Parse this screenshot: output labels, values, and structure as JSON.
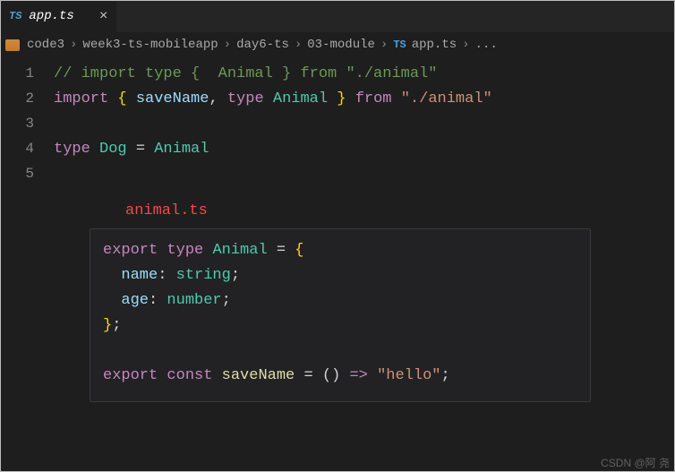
{
  "tab": {
    "icon_label": "TS",
    "filename": "app.ts",
    "close_glyph": "×"
  },
  "breadcrumb": {
    "items": [
      "code3",
      "week3-ts-mobileapp",
      "day6-ts",
      "03-module"
    ],
    "file_badge": "TS",
    "file": "app.ts",
    "trailing": "...",
    "sep": "›"
  },
  "code": {
    "lines": [
      {
        "n": "1",
        "tokens": [
          {
            "t": "// import type {  Animal } from \"./animal\"",
            "c": "c-comment"
          }
        ]
      },
      {
        "n": "2",
        "tokens": [
          {
            "t": "import ",
            "c": "c-keyword"
          },
          {
            "t": "{ ",
            "c": "c-brace"
          },
          {
            "t": "saveName",
            "c": "c-ident"
          },
          {
            "t": ", ",
            "c": "c-punc"
          },
          {
            "t": "type ",
            "c": "c-keyword"
          },
          {
            "t": "Animal",
            "c": "c-type"
          },
          {
            "t": " }",
            "c": "c-brace"
          },
          {
            "t": " from ",
            "c": "c-keyword"
          },
          {
            "t": "\"./animal\"",
            "c": "c-string"
          }
        ]
      },
      {
        "n": "3",
        "tokens": []
      },
      {
        "n": "4",
        "tokens": [
          {
            "t": "type ",
            "c": "c-keyword"
          },
          {
            "t": "Dog",
            "c": "c-type"
          },
          {
            "t": " = ",
            "c": "c-plain"
          },
          {
            "t": "Animal",
            "c": "c-type"
          }
        ]
      },
      {
        "n": "5",
        "tokens": []
      }
    ]
  },
  "snippet": {
    "label": "animal.ts",
    "lines": [
      [
        {
          "t": "export ",
          "c": "c-keyword"
        },
        {
          "t": "type ",
          "c": "c-keyword"
        },
        {
          "t": "Animal",
          "c": "c-type"
        },
        {
          "t": " = ",
          "c": "c-plain"
        },
        {
          "t": "{",
          "c": "c-brace"
        }
      ],
      [
        {
          "t": "  name",
          "c": "c-ident"
        },
        {
          "t": ": ",
          "c": "c-punc"
        },
        {
          "t": "string",
          "c": "c-type"
        },
        {
          "t": ";",
          "c": "c-punc"
        }
      ],
      [
        {
          "t": "  age",
          "c": "c-ident"
        },
        {
          "t": ": ",
          "c": "c-punc"
        },
        {
          "t": "number",
          "c": "c-type"
        },
        {
          "t": ";",
          "c": "c-punc"
        }
      ],
      [
        {
          "t": "}",
          "c": "c-brace"
        },
        {
          "t": ";",
          "c": "c-punc"
        }
      ],
      [],
      [
        {
          "t": "export ",
          "c": "c-keyword"
        },
        {
          "t": "const ",
          "c": "c-keyword"
        },
        {
          "t": "saveName",
          "c": "c-func"
        },
        {
          "t": " = ",
          "c": "c-plain"
        },
        {
          "t": "() ",
          "c": "c-punc"
        },
        {
          "t": "=>",
          "c": "c-keyword"
        },
        {
          "t": " ",
          "c": "c-plain"
        },
        {
          "t": "\"hello\"",
          "c": "c-string"
        },
        {
          "t": ";",
          "c": "c-punc"
        }
      ]
    ]
  },
  "watermark": "CSDN @阿 尧"
}
